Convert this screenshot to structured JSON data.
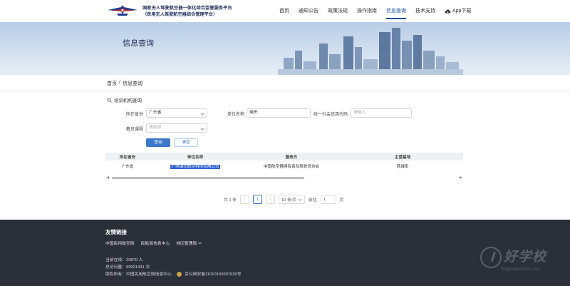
{
  "header": {
    "brand_line1": "国家无人驾驶航空器一体化综合监管服务平台",
    "brand_line2": "（民用无人驾驶航空器综合管理平台）",
    "nav": [
      {
        "label": "首页"
      },
      {
        "label": "通知公告"
      },
      {
        "label": "政策法规"
      },
      {
        "label": "操作指南"
      },
      {
        "label": "信息查询",
        "active": true
      },
      {
        "label": "技术支持"
      }
    ],
    "app_download": "App下载"
  },
  "banner": {
    "title": "信息查询"
  },
  "breadcrumb": {
    "home": "首页",
    "sep": "/",
    "current": "信息查询"
  },
  "search": {
    "section_title": "培训机构查询",
    "province_label": "所在省份",
    "province_value": "广东省",
    "unit_label": "单位名称",
    "unit_value": "璃天",
    "credit_label": "统一社会信用代码",
    "credit_placeholder": "请输入...",
    "course_label": "教员课程",
    "course_placeholder": "请选择...",
    "query_btn": "查询",
    "clear_btn": "清空"
  },
  "table": {
    "headers": [
      "所在省份",
      "单位名称",
      "服务方",
      "主营基地"
    ],
    "rows": [
      [
        "广东省",
        "广州璃天航空科技有限公司",
        "中国航空器拥有者及驾驶员协会",
        "荔城街"
      ]
    ]
  },
  "pagination": {
    "total": "共 1 条",
    "prev": "‹",
    "page": "1",
    "next": "›",
    "size": "10 条/页",
    "goto_label": "前往",
    "goto_value": "1",
    "page_unit": "页"
  },
  "footer": {
    "title": "友情链接",
    "links": [
      "中国民用航空网",
      "民航局信息中心",
      "地区管理局"
    ],
    "online": "当前在线：20870 人",
    "visits": "总访问量：99921431 次",
    "copyright": "版权所有：中国民用航空局信息中心",
    "icp": "京公网安备11010102007630号",
    "watermark": "好学校",
    "watermark_url": "91goodschool.com"
  },
  "colors": {
    "primary": "#3a78c9",
    "nav_active": "#1a4ea3",
    "footer_bg": "#2b2f3a",
    "highlight": "#2f5fd1"
  }
}
